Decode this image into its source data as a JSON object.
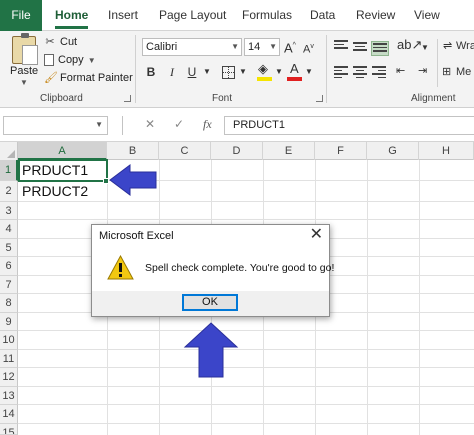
{
  "ribbon_tabs": [
    "File",
    "Home",
    "Insert",
    "Page Layout",
    "Formulas",
    "Data",
    "Review",
    "View"
  ],
  "clipboard": {
    "paste_label": "Paste",
    "cut_label": "Cut",
    "copy_label": "Copy",
    "format_painter_label": "Format Painter",
    "group_label": "Clipboard"
  },
  "font": {
    "name": "Calibri",
    "size": "14",
    "group_label": "Font",
    "bold_glyph": "B",
    "italic_glyph": "I",
    "underline_glyph": "U",
    "grow_glyph": "A^",
    "shrink_glyph": "Av",
    "font_color_glyph": "A"
  },
  "alignment": {
    "group_label": "Alignment",
    "wrap_partial": "Wra",
    "merge_partial": "Me"
  },
  "formula_bar": {
    "name_box_value": "",
    "cancel_glyph": "✕",
    "enter_glyph": "✓",
    "fx_glyph": "fx",
    "formula_value": "PRDUCT1"
  },
  "columns": [
    "A",
    "B",
    "C",
    "D",
    "E",
    "F",
    "G",
    "H"
  ],
  "rows": [
    "1",
    "2",
    "3",
    "4",
    "5",
    "6",
    "7",
    "8",
    "9",
    "10",
    "11",
    "12",
    "13",
    "14",
    "15"
  ],
  "cells": {
    "A1": "PRDUCT1",
    "A2": "PRDUCT2"
  },
  "dialog": {
    "title": "Microsoft Excel",
    "close_glyph": "✕",
    "message": "Spell check complete. You're good to go!",
    "ok_label": "OK"
  },
  "colors": {
    "excel_green": "#217346",
    "annotation_arrow": "#3b45c9",
    "warning_yellow": "#f2c811"
  }
}
